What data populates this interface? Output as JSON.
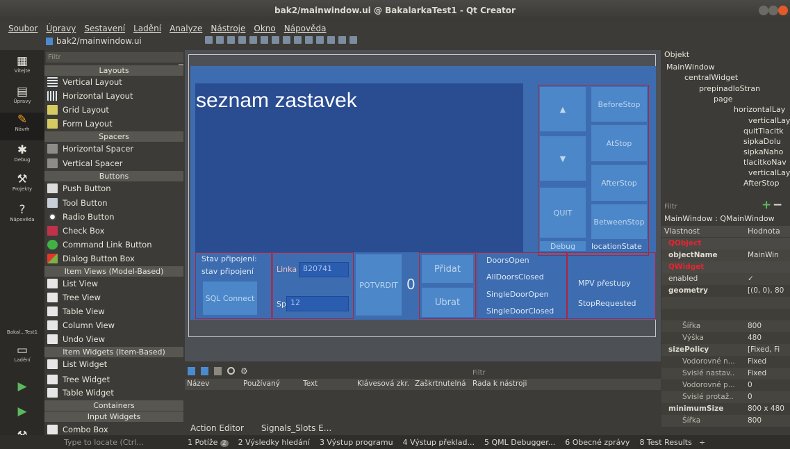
{
  "window": {
    "title": "bak2/mainwindow.ui @ BakalarkaTest1 - Qt Creator"
  },
  "menu": [
    "Soubor",
    "Úpravy",
    "Sestavení",
    "Ladění",
    "Analyze",
    "Nástroje",
    "Okno",
    "Nápověda"
  ],
  "open_file": "bak2/mainwindow.ui",
  "modes": [
    {
      "label": "Vítejte",
      "icon": "grid-icon"
    },
    {
      "label": "Úpravy",
      "icon": "document-icon"
    },
    {
      "label": "Návrh",
      "icon": "pencil-icon"
    },
    {
      "label": "Debug",
      "icon": "bug-icon"
    },
    {
      "label": "Projekty",
      "icon": "wrench-icon"
    },
    {
      "label": "Nápověda",
      "icon": "help-icon"
    }
  ],
  "build": {
    "target_label": "Bakal...Test1",
    "debug_label": "Ladění"
  },
  "widget_box": {
    "filter_placeholder": "Filtr",
    "categories": {
      "layouts": "Layouts",
      "spacers": "Spacers",
      "buttons": "Buttons",
      "item_views": "Item Views (Model-Based)",
      "item_widgets": "Item Widgets (Item-Based)",
      "containers": "Containers",
      "input_widgets": "Input Widgets"
    },
    "items": {
      "vertical_layout": "Vertical Layout",
      "horizontal_layout": "Horizontal Layout",
      "grid_layout": "Grid Layout",
      "form_layout": "Form Layout",
      "horizontal_spacer": "Horizontal Spacer",
      "vertical_spacer": "Vertical Spacer",
      "push_button": "Push Button",
      "tool_button": "Tool Button",
      "radio_button": "Radio Button",
      "check_box": "Check Box",
      "command_link_button": "Command Link Button",
      "dialog_button_box": "Dialog Button Box",
      "list_view": "List View",
      "tree_view": "Tree View",
      "table_view": "Table View",
      "column_view": "Column View",
      "undo_view": "Undo View",
      "list_widget": "List Widget",
      "tree_widget": "Tree Widget",
      "table_widget": "Table Widget",
      "combo_box": "Combo Box"
    }
  },
  "form": {
    "seznam": "seznam zastavek",
    "up": "▲",
    "down": "▼",
    "quit": "QUIT",
    "debug": "Debug",
    "before_stop": "BeforeStop",
    "at_stop": "AtStop",
    "after_stop": "AfterStop",
    "between_stop": "BetweenStop",
    "location_state": "locationState",
    "stav_pripojeni_label": "Stav připojení:",
    "stav_pripojeni_value": "stav připojení",
    "sql_connect": "SQL Connect",
    "linka_label": "Linka",
    "linka_value": "820741",
    "spoj_label": "Spoj",
    "spoj_value": "12",
    "potvrdit": "POTVRDIT",
    "counter": "0",
    "pridat": "Přidat",
    "ubrat": "Ubrat",
    "doors_open": "DoorsOpen",
    "all_doors_closed": "AllDoorsClosed",
    "single_door_open": "SingleDoorOpen",
    "single_door_closed": "SingleDoorClosed",
    "mpv_prestupy": "MPV přestupy",
    "stop_requested": "StopRequested"
  },
  "action_editor": {
    "filter_placeholder": "Filtr",
    "columns": [
      "Název",
      "Používaný",
      "Text",
      "Klávesová zkr.",
      "Zaškrtnutelná",
      "Rada k nástroji"
    ],
    "tabs": [
      "Action Editor",
      "Signals_Slots E..."
    ]
  },
  "object_inspector": {
    "header": "Objekt",
    "tree": [
      "MainWindow",
      "centralWidget",
      "prepinadloStran",
      "page",
      "horizontalLay",
      "verticalLay",
      "quitTlacitk",
      "sipkaDolu",
      "sipkaNaho",
      "tlacitkoNav",
      "verticalLay",
      "AfterStop"
    ]
  },
  "property_editor": {
    "filter_placeholder": "Filtr",
    "title": "MainWindow : QMainWindow",
    "headers": {
      "property": "Vlastnost",
      "value": "Hodnota"
    },
    "rows": [
      {
        "k": "QObject",
        "v": "",
        "type": "section"
      },
      {
        "k": "objectName",
        "v": "MainWin",
        "type": "bold"
      },
      {
        "k": "QWidget",
        "v": "",
        "type": "section"
      },
      {
        "k": "enabled",
        "v": "✓",
        "type": "normal"
      },
      {
        "k": "geometry",
        "v": "[(0, 0), 80",
        "type": "bold"
      },
      {
        "k": "",
        "v": "",
        "type": "normal"
      },
      {
        "k": "",
        "v": "",
        "type": "normal"
      },
      {
        "k": "Šířka",
        "v": "800",
        "type": "sub"
      },
      {
        "k": "Výška",
        "v": "480",
        "type": "sub"
      },
      {
        "k": "sizePolicy",
        "v": "[Fixed, Fi",
        "type": "bold"
      },
      {
        "k": "Vodorovné n...",
        "v": "Fixed",
        "type": "sub"
      },
      {
        "k": "Svislé nastav...",
        "v": "Fixed",
        "type": "sub"
      },
      {
        "k": "Vodorovné p...",
        "v": "0",
        "type": "sub"
      },
      {
        "k": "Svislé protaž...",
        "v": "0",
        "type": "sub"
      },
      {
        "k": "minimumSize",
        "v": "800 x 480",
        "type": "bold"
      },
      {
        "k": "Šířka",
        "v": "800",
        "type": "sub"
      }
    ]
  },
  "status": {
    "locate_placeholder": "Type to locate (Ctrl...",
    "tabs": [
      "1 Potíže",
      "2 Výsledky hledání",
      "3 Výstup programu",
      "4 Výstup překlad...",
      "5 QML Debugger...",
      "6 Obecné zprávy",
      "8 Test Results"
    ],
    "problems_badge": "2"
  },
  "colors": {
    "form_bg": "#3d6db0",
    "panel_dark": "#2a4c91",
    "button": "#4c87c9",
    "red_outline": "#b2233a",
    "section_red": "#e8252e"
  }
}
